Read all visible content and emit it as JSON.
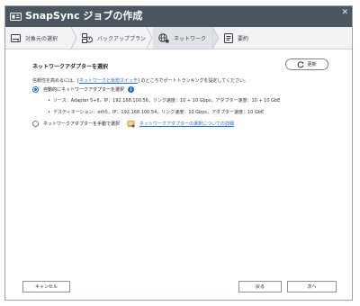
{
  "window": {
    "title": "SnapSync ジョブの作成"
  },
  "steps": [
    {
      "label": "対象元の選択",
      "icon": "storage-icon"
    },
    {
      "label": "バックアッププラン",
      "icon": "backup-plan-icon"
    },
    {
      "label": "ネットワーク",
      "icon": "network-icon",
      "active": true
    },
    {
      "label": "要約",
      "icon": "summary-icon"
    }
  ],
  "section": {
    "title": "ネットワークアダプターを選択",
    "refresh_label": "更新",
    "description": {
      "prefix": "信頼性を高めるには、[",
      "link": "ネットワークと仮想スイッチ",
      "suffix": "] のところでポートトランキングを設定してください。"
    }
  },
  "options": {
    "auto": {
      "label": "自動的にネットワークアダプターを選択",
      "checked": true,
      "details": [
        "ソース：Adapter 5+6，IP：192.168.100.56，リンク速度：10 + 10 Gbps，アダプター速度：10 + 10 GbE",
        "デスティネーション：eth5，IP：192.168.100.54，リンク速度：10 Gbps，アダプター速度：10 GbE"
      ]
    },
    "manual": {
      "label": "ネットワークアダプターを手動で選択",
      "checked": false,
      "help_link": "ネットワークアダプターの選択についての詳細"
    }
  },
  "footer": {
    "cancel_label": "キャンセル",
    "back_label": "戻る",
    "next_label": "次へ"
  },
  "colors": {
    "titlebar": "#4c5661",
    "accent": "#1a6fc7",
    "step_bar": "#f1f3f5"
  }
}
